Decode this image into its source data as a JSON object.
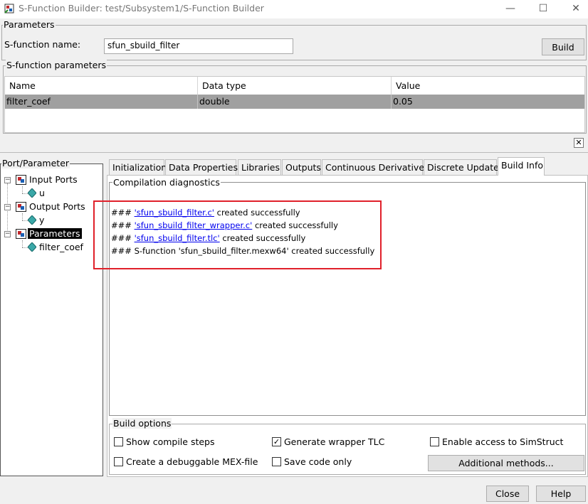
{
  "window": {
    "title": "S-Function Builder: test/Subsystem1/S-Function Builder",
    "minimize_glyph": "—",
    "maximize_glyph": "☐",
    "close_glyph": "✕"
  },
  "parameters_group": {
    "legend": "Parameters",
    "sfun_name_label": "S-function name:",
    "sfun_name_value": "sfun_sbuild_filter",
    "build_label": "Build"
  },
  "sfun_params": {
    "legend": "S-function parameters",
    "columns": [
      "Name",
      "Data type",
      "Value"
    ],
    "rows": [
      [
        "filter_coef",
        "double",
        "0.05"
      ]
    ],
    "close_glyph": "✕"
  },
  "tree": {
    "legend": "Port/Parameter",
    "input_ports": "Input Ports",
    "input_u": "u",
    "output_ports": "Output Ports",
    "output_y": "y",
    "parameters": "Parameters",
    "param_filter_coef": "filter_coef",
    "expander_glyph": "−"
  },
  "tabs": [
    "Initialization",
    "Data Properties",
    "Libraries",
    "Outputs",
    "Continuous Derivatives",
    "Discrete Update",
    "Build Info"
  ],
  "diagnostics": {
    "legend": "Compilation diagnostics",
    "prefix": "###",
    "lines": [
      {
        "link": "'sfun_sbuild_filter.c'",
        "suffix": " created successfully"
      },
      {
        "link": "'sfun_sbuild_filter_wrapper.c'",
        "suffix": " created successfully"
      },
      {
        "link": "'sfun_sbuild_filter.tlc'",
        "suffix": " created successfully"
      }
    ],
    "last_line": "### S-function 'sfun_sbuild_filter.mexw64' created successfully"
  },
  "build_options": {
    "legend": "Build options",
    "show_compile_steps": "Show compile steps",
    "generate_wrapper_tlc": "Generate wrapper TLC",
    "enable_simstruct": "Enable access to SimStruct",
    "debuggable_mex": "Create a debuggable MEX-file",
    "save_code_only": "Save code only",
    "additional_methods": "Additional methods...",
    "check_glyph": "✓"
  },
  "footer": {
    "close_label": "Close",
    "help_label": "Help"
  },
  "colors": {
    "highlight_box": "#e0202a",
    "link": "#0000ee",
    "selected_row": "#a0a0a0"
  }
}
